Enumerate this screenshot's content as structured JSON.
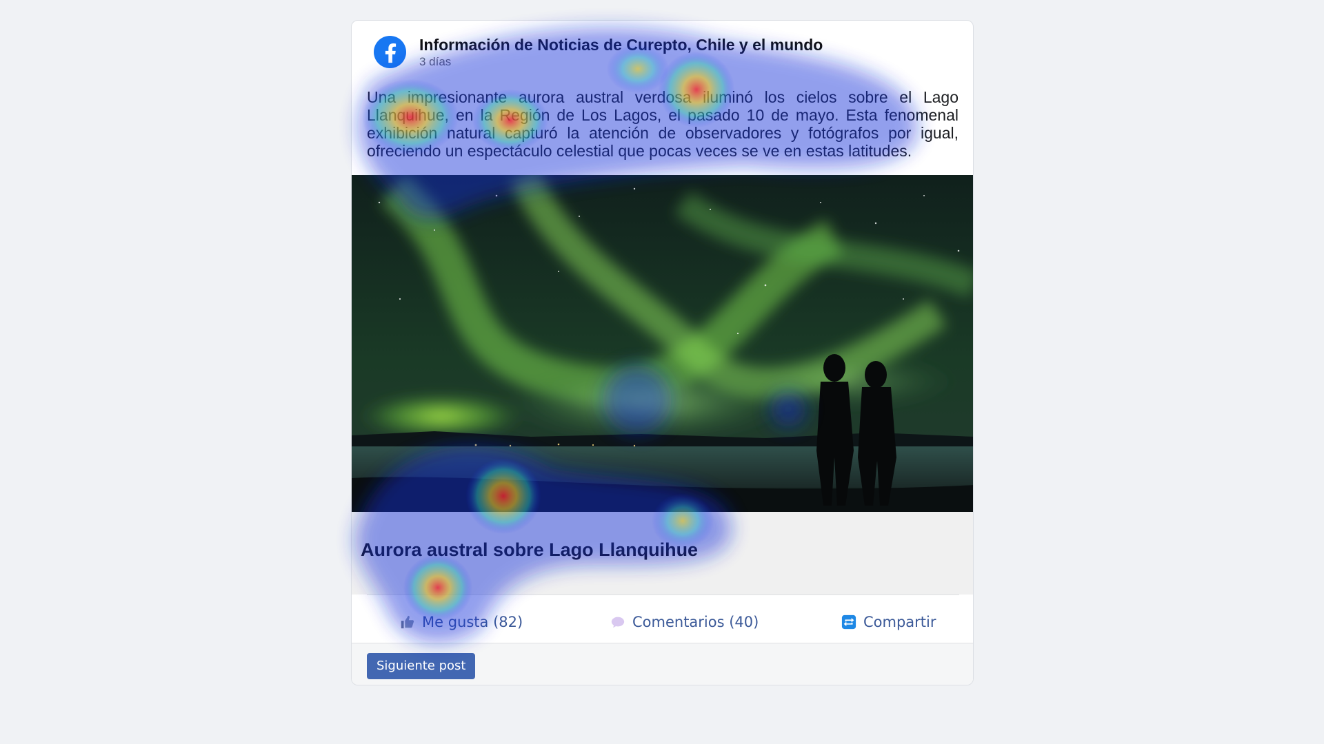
{
  "post": {
    "page_name": "Información de Noticias de Curepto, Chile y el mundo",
    "time": "3 días",
    "text": "Una impresionante aurora austral verdosa iluminó los cielos sobre el Lago Llanquihue, en la Región de Los Lagos, el pasado 10 de mayo. Esta fenomenal exhibición natural capturó la atención de observadores y fotógrafos por igual, ofreciendo un espectáculo celestial que pocas veces se ve en estas latitudes.",
    "caption": "Aurora austral sobre Lago Llanquihue",
    "photo_icon": "aurora-photo"
  },
  "actions": {
    "like": "Me gusta (82)",
    "comment": "Comentarios (40)",
    "share": "Compartir"
  },
  "footer": {
    "next_label": "Siguiente post"
  },
  "icons": {
    "logo": "facebook-logo-icon",
    "like": "thumbs-up-icon",
    "comment": "speech-bubble-icon",
    "share": "share-arrows-icon"
  },
  "colors": {
    "brand": "#1877f2",
    "link": "#3b5998",
    "button": "#4267b2",
    "background": "#f0f2f5"
  }
}
